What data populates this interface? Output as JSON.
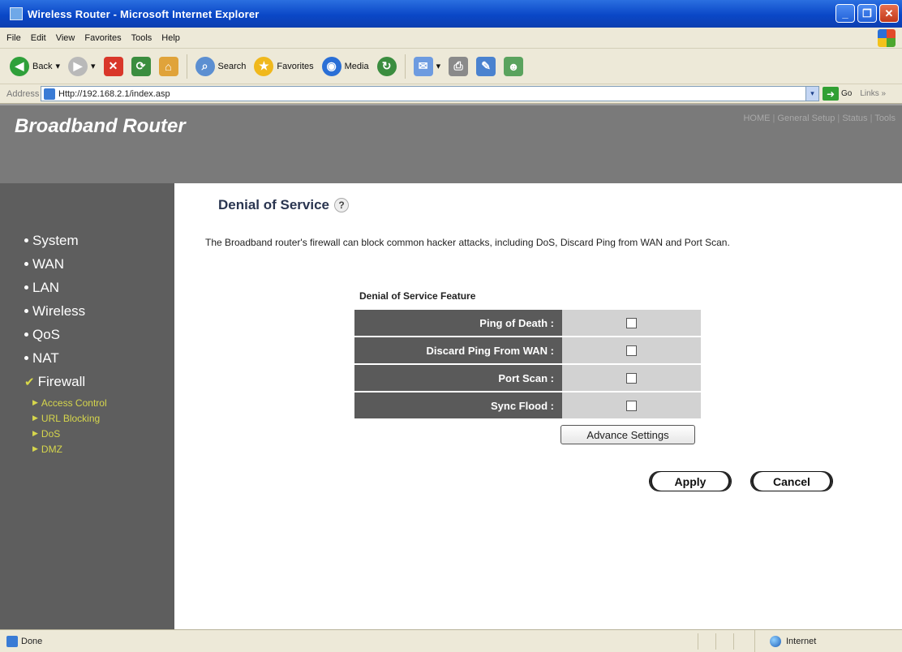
{
  "window": {
    "title": "Wireless Router - Microsoft Internet Explorer",
    "minimize_glyph": "_",
    "maximize_glyph": "❐",
    "close_glyph": "✕"
  },
  "menubar": {
    "items": [
      "File",
      "Edit",
      "View",
      "Favorites",
      "Tools",
      "Help"
    ]
  },
  "toolbar": {
    "back_label": "Back",
    "back_glyph": "◀",
    "forward_glyph": "▶",
    "stop_glyph": "✕",
    "refresh_glyph": "⟳",
    "home_glyph": "⌂",
    "search_label": "Search",
    "search_glyph": "⌕",
    "favorites_label": "Favorites",
    "favorites_glyph": "★",
    "media_label": "Media",
    "media_glyph": "◉",
    "dropdown_glyph": "▾",
    "history_glyph": "↻",
    "mail_glyph": "✉",
    "print_glyph": "⎙",
    "edit_glyph": "✎",
    "messenger_glyph": "☻"
  },
  "addressbar": {
    "label": "Address",
    "url": "Http://192.168.2.1/index.asp",
    "dropdown_glyph": "▾",
    "go_glyph": "➜",
    "go_label": "Go",
    "links_label": "Links »"
  },
  "router": {
    "brand": "Broadband Router",
    "top_nav": [
      "HOME",
      "General Setup",
      "Status",
      "Tools"
    ],
    "nav_separator": " | "
  },
  "sidebar": {
    "items": [
      {
        "label": "System"
      },
      {
        "label": "WAN"
      },
      {
        "label": "LAN"
      },
      {
        "label": "Wireless"
      },
      {
        "label": "QoS"
      },
      {
        "label": "NAT"
      },
      {
        "label": "Firewall"
      }
    ],
    "active_check_glyph": "✔",
    "sub_marker_glyph": "▶",
    "sub_items": [
      "Access Control",
      "URL Blocking",
      "DoS",
      "DMZ"
    ]
  },
  "main": {
    "title": "Denial of Service",
    "help_glyph": "?",
    "description": "The Broadband router's firewall can block common hacker attacks, including DoS, Discard Ping from WAN and Port Scan.",
    "section_heading": "Denial of Service Feature",
    "features": [
      {
        "label": "Ping of Death :",
        "checked": false
      },
      {
        "label": "Discard Ping From WAN :",
        "checked": false
      },
      {
        "label": "Port Scan :",
        "checked": false
      },
      {
        "label": "Sync Flood :",
        "checked": false
      }
    ],
    "advance_button": "Advance Settings",
    "apply_button": "Apply",
    "cancel_button": "Cancel"
  },
  "statusbar": {
    "status": "Done",
    "zone": "Internet"
  },
  "colors": {
    "titlebar_blue": "#0a47c7",
    "chrome_beige": "#ede9d8",
    "header_gray": "#7a7a7a",
    "sidebar_gray": "#5e5e5e",
    "submenu_yellow": "#d6d64c",
    "label_cell_gray": "#5a5a5a",
    "value_cell_gray": "#d2d2d2"
  }
}
